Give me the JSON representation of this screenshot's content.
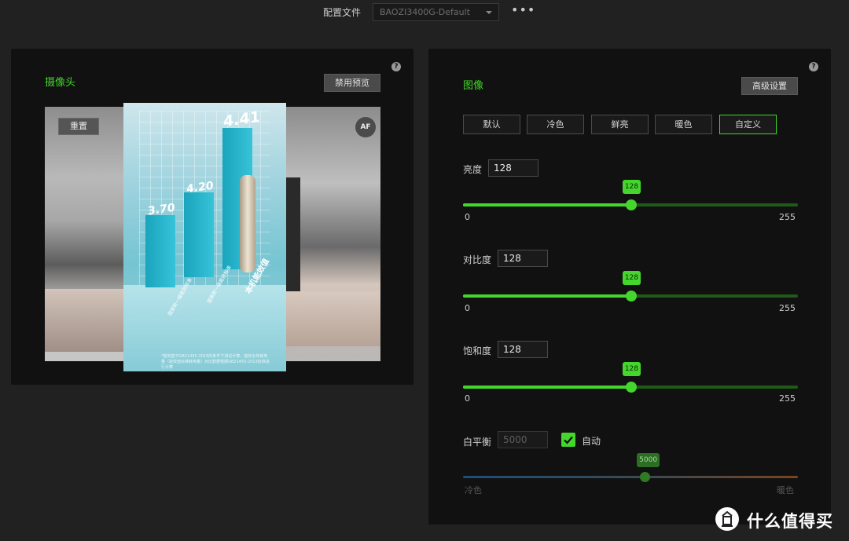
{
  "top_bar": {
    "profile_label": "配置文件",
    "profile_value": "BAOZI3400G-Default",
    "more_label": "•••"
  },
  "camera_panel": {
    "title": "摄像头",
    "help": "?",
    "disable_preview_button": "禁用预览",
    "reset_button": "重置",
    "af_badge": "AF",
    "preview_content": {
      "values": [
        "3.70",
        "4.20",
        "4.41"
      ],
      "labels": [
        "国家新一级能效标准",
        "国家新一级能效标准",
        "本机能效值"
      ],
      "fine_print": "*能效基于GB21455-2019的条件下测试计算，能效全年耗电量（能效值标准耗电量）对比数据根据GB21455-2013标准进行计算"
    }
  },
  "image_panel": {
    "title": "图像",
    "help": "?",
    "advanced_button": "高级设置",
    "presets": [
      {
        "label": "默认",
        "active": false
      },
      {
        "label": "冷色",
        "active": false
      },
      {
        "label": "鲜亮",
        "active": false
      },
      {
        "label": "暖色",
        "active": false
      },
      {
        "label": "自定义",
        "active": true
      }
    ],
    "brightness": {
      "label": "亮度",
      "value": "128",
      "min": "0",
      "max": "255",
      "level": 128,
      "range": 255
    },
    "contrast": {
      "label": "对比度",
      "value": "128",
      "min": "0",
      "max": "255",
      "level": 128,
      "range": 255
    },
    "saturation": {
      "label": "饱和度",
      "value": "128",
      "min": "0",
      "max": "255",
      "level": 128,
      "range": 255
    },
    "white_balance": {
      "label": "白平衡",
      "value": "5000",
      "auto_label": "自动",
      "auto_checked": true,
      "bubble": "5000",
      "min_label": "冷色",
      "max_label": "暖色",
      "level_fraction": 0.545
    }
  },
  "watermark": {
    "text": "什么值得买",
    "logo_char": "值"
  },
  "colors": {
    "accent": "#44d62c",
    "panel": "#111111",
    "background": "#212121"
  }
}
